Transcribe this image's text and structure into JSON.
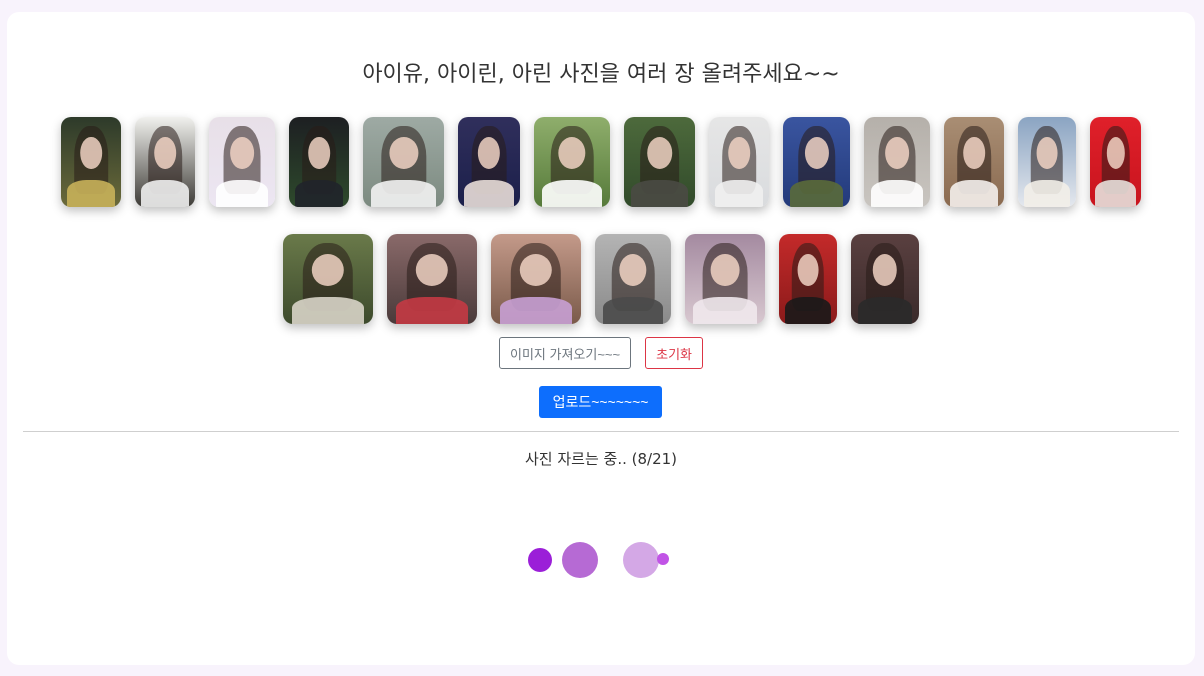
{
  "heading": "아이유, 아이린, 아린 사진을 여러 장 올려주세요~~",
  "gallery": {
    "row1": [
      {
        "name": "photo-1",
        "bg": "#6b6a3a",
        "top": "#2d3a2a",
        "cloth": "#c8b15a"
      },
      {
        "name": "photo-2",
        "bg": "#3d3b36",
        "top": "#f1f1ee",
        "cloth": "#eeeeee"
      },
      {
        "name": "photo-3",
        "bg": "#ece6f2",
        "top": "#e8e0e8",
        "cloth": "#ffffff"
      },
      {
        "name": "photo-4",
        "bg": "#2e4a2c",
        "top": "#1d1f22",
        "cloth": "#20242a"
      },
      {
        "name": "photo-5",
        "bg": "#7c8a80",
        "top": "#9eaaa4",
        "cloth": "#f2f2f2"
      },
      {
        "name": "photo-6",
        "bg": "#1b1f4a",
        "top": "#302f5c",
        "cloth": "#e8ddd8"
      },
      {
        "name": "photo-7",
        "bg": "#567a3a",
        "top": "#8fae6c",
        "cloth": "#ffffff"
      },
      {
        "name": "photo-8",
        "bg": "#314a2a",
        "top": "#4d6a3c",
        "cloth": "#4a4a44"
      },
      {
        "name": "photo-9",
        "bg": "#d9dbde",
        "top": "#e6e6e6",
        "cloth": "#f0f0f0"
      },
      {
        "name": "photo-10",
        "bg": "#233a7a",
        "top": "#3a55a0",
        "cloth": "#5a6a3a"
      },
      {
        "name": "photo-11",
        "bg": "#c9c5c0",
        "top": "#b5b0aa",
        "cloth": "#ffffff"
      },
      {
        "name": "photo-12",
        "bg": "#8a6a50",
        "top": "#a98e74",
        "cloth": "#f4f0ec"
      },
      {
        "name": "photo-13",
        "bg": "#e4e8ee",
        "top": "#8aa4c2",
        "cloth": "#f2eee8"
      },
      {
        "name": "photo-14",
        "bg": "#c8141e",
        "top": "#e0202a",
        "cloth": "#e6e0dc"
      }
    ],
    "row2": [
      {
        "name": "photo-15",
        "bg": "#3d4a2c",
        "top": "#6a7a4a",
        "cloth": "#d8d4c8"
      },
      {
        "name": "photo-16",
        "bg": "#4a3a3a",
        "top": "#8a6a6a",
        "cloth": "#c43a44"
      },
      {
        "name": "photo-17",
        "bg": "#7a5a4a",
        "top": "#c49a8a",
        "cloth": "#c8a0d4"
      },
      {
        "name": "photo-18",
        "bg": "#8a8a8a",
        "top": "#b4b4b4",
        "cloth": "#4a4a4a"
      },
      {
        "name": "photo-19",
        "bg": "#d8c8d0",
        "top": "#a48aa0",
        "cloth": "#f0e8ec"
      },
      {
        "name": "photo-20",
        "bg": "#8a1a1a",
        "top": "#c42a2a",
        "cloth": "#1a1a1a"
      },
      {
        "name": "photo-21",
        "bg": "#3a2a2a",
        "top": "#5a4040",
        "cloth": "#2a2a2a"
      }
    ]
  },
  "buttons": {
    "import_label": "이미지 가져오기~~~",
    "reset_label": "초기화",
    "upload_label": "업로드~~~~~~~"
  },
  "status": {
    "text": "사진 자르는 중.. (8/21)",
    "progress_current": 8,
    "progress_total": 21
  },
  "loader": {
    "dot_colors": [
      "#9b1fd8",
      "#b66ad4",
      "#d4a8e6",
      "#c154e6"
    ]
  },
  "colors": {
    "primary": "#0d6efd",
    "danger": "#dc3545",
    "secondary": "#6c757d",
    "background": "#f8f3fc"
  }
}
